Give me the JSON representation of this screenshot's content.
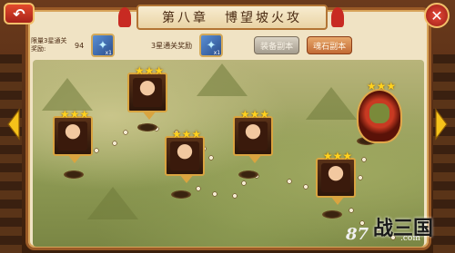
{
  "header": {
    "chapter": "第八章",
    "stage_name": "博望坡火攻",
    "back_icon": "back-arrow-icon",
    "close_icon": "close-icon"
  },
  "rewards": {
    "limit_label": "限量3星通关奖励:",
    "limit_count": "94",
    "limit_item_qty": "x1",
    "three_star_label": "3星通关奖励",
    "three_star_item_qty": "x1",
    "equip_copy_label": "装备副本",
    "soul_copy_label": "魂石副本"
  },
  "stages": [
    {
      "name": "stage-1",
      "stars": "★★★",
      "portrait": "male-general-portrait"
    },
    {
      "name": "stage-2",
      "stars": "★★★",
      "portrait": "female-portrait"
    },
    {
      "name": "stage-3",
      "stars": "★★★",
      "portrait": "female-portrait"
    },
    {
      "name": "stage-4",
      "stars": "★★★",
      "portrait": "male-general-portrait"
    },
    {
      "name": "stage-5",
      "stars": "★★★",
      "portrait": "male-general-portrait"
    },
    {
      "name": "boss",
      "stars": "★★★",
      "portrait": "boss-portrait"
    }
  ],
  "logo": {
    "number": "87",
    "chars": "战三国",
    "url": ".com"
  },
  "colors": {
    "panel_bg": "#f0e3c4",
    "frame": "#9a5a26",
    "star": "#ffd21e",
    "soul_button": "#c26a34",
    "equip_button": "#a59d8e"
  }
}
